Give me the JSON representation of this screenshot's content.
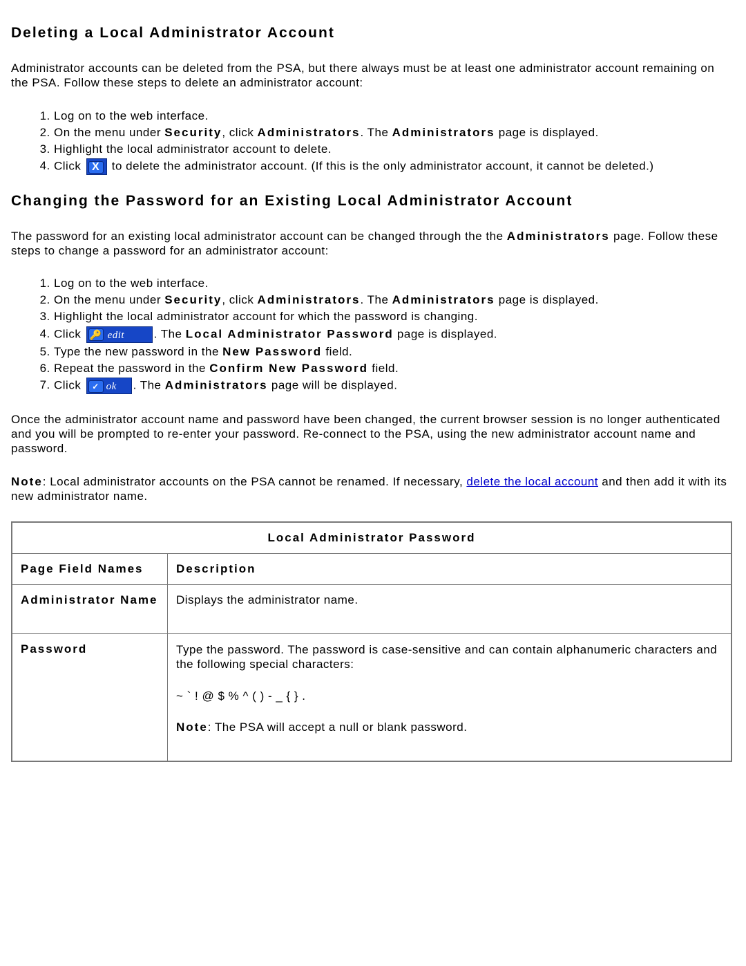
{
  "section1": {
    "heading": "Deleting a Local Administrator Account",
    "intro": "Administrator accounts can be deleted from the PSA, but there always must be at least one administrator account remaining on the PSA. Follow these steps to delete an administrator account:",
    "steps": {
      "s1": "Log on to the web interface.",
      "s2a": "On the menu under ",
      "s2b": "Security",
      "s2c": ", click ",
      "s2d": "Administrators",
      "s2e": ". The ",
      "s2f": "Administrators",
      "s2g": " page is displayed.",
      "s3": "Highlight the local administrator account to delete.",
      "s4a": "Click ",
      "s4b": " to delete the administrator account. (If this is the only administrator account, it cannot be deleted.)"
    }
  },
  "section2": {
    "heading": "Changing the Password for an Existing Local Administrator Account",
    "intro_a": "The password for an existing local administrator account can be changed through the the ",
    "intro_b": "Administrators",
    "intro_c": " page. Follow these steps to change a password for an administrator account:",
    "steps": {
      "s1": "Log on to the web interface.",
      "s2a": "On the menu under ",
      "s2b": "Security",
      "s2c": ", click ",
      "s2d": "Administrators",
      "s2e": ". The ",
      "s2f": "Administrators",
      "s2g": " page is displayed.",
      "s3": "Highlight the local administrator account for which the password is changing.",
      "s4a": "Click ",
      "s4b": ". The ",
      "s4c": "Local Administrator Password",
      "s4d": " page is displayed.",
      "s5a": "Type the new password in the ",
      "s5b": "New Password",
      "s5c": " field.",
      "s6a": "Repeat the password in the ",
      "s6b": "Confirm New Password",
      "s6c": " field.",
      "s7a": "Click ",
      "s7b": ". The ",
      "s7c": "Administrators",
      "s7d": " page will be displayed."
    },
    "para2": "Once the administrator account name and password have been changed, the current browser session is no longer authenticated and you will be prompted to re-enter your password. Re-connect to the PSA, using the new administrator account name and password.",
    "note_a": "Note",
    "note_b": ": Local administrator accounts on the PSA cannot be renamed. If necessary, ",
    "note_link": "delete the local account",
    "note_c": " and then add it with its new administrator name."
  },
  "buttons": {
    "edit_label": "edit",
    "ok_label": "ok"
  },
  "table": {
    "title": "Local Administrator Password",
    "col1": "Page Field Names",
    "col2": "Description",
    "row1": {
      "field": "Administrator Name",
      "desc": "Displays the administrator name."
    },
    "row2": {
      "field": "Password",
      "desc1": "Type the password. The password is case-sensitive and can contain alphanumeric characters and the following special characters:",
      "desc2": "~ ` ! @ $ % ^ ( ) - _ { } .",
      "desc3a": "Note",
      "desc3b": ": The PSA will accept a null or blank password."
    }
  }
}
